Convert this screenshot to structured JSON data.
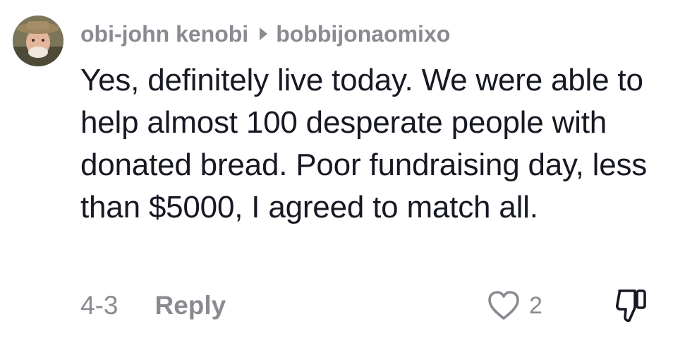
{
  "comment": {
    "author": "obi-john kenobi",
    "reply_to": "bobbijonaomixo",
    "text": "Yes, definitely live today. We were able to help almost 100 desperate people with donated bread. Poor fundraising day, less than $5000, I agreed to match all.",
    "date": "4-3",
    "reply_label": "Reply",
    "like_count": "2",
    "icons": {
      "reply_to": "triangle-right-icon",
      "like": "heart-outline-icon",
      "dislike": "thumbs-down-outline-icon"
    },
    "colors": {
      "primary_text": "#161823",
      "secondary_text": "#8a8b91"
    }
  }
}
